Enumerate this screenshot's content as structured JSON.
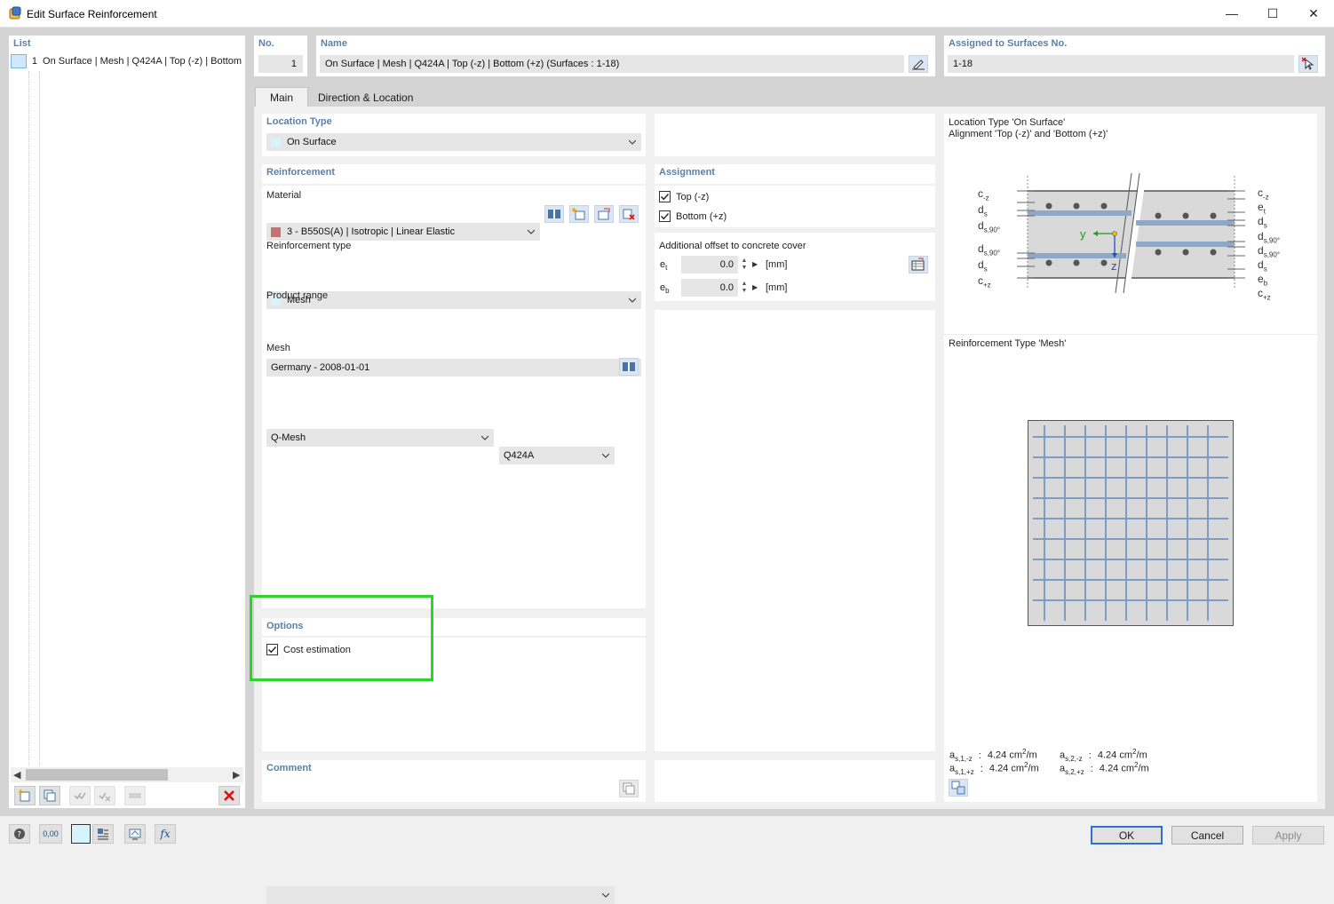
{
  "window": {
    "title": "Edit Surface Reinforcement",
    "controls": {
      "minimize": "—",
      "maximize": "☐",
      "close": "✕"
    }
  },
  "list": {
    "header": "List",
    "items": [
      {
        "no": "1",
        "label": "On Surface | Mesh | Q424A | Top (-z) | Bottom"
      }
    ]
  },
  "header": {
    "no_label": "No.",
    "no_value": "1",
    "name_label": "Name",
    "name_value": "On Surface | Mesh | Q424A | Top (-z) | Bottom (+z) (Surfaces : 1-18)",
    "assigned_label": "Assigned to Surfaces No.",
    "assigned_value": "1-18"
  },
  "tabs": [
    {
      "label": "Main",
      "active": true
    },
    {
      "label": "Direction & Location",
      "active": false
    }
  ],
  "location_type": {
    "label": "Location Type",
    "value": "On Surface",
    "swatch": "#d6f4fb"
  },
  "reinforcement": {
    "label": "Reinforcement",
    "material_label": "Material",
    "material_value": "3 - B550S(A) | Isotropic | Linear Elastic",
    "material_swatch": "#c27373",
    "type_label": "Reinforcement type",
    "type_value": "Mesh",
    "type_swatch": "#d6f4fb",
    "range_label": "Product range",
    "range_value": "Germany - 2008-01-01",
    "mesh_label": "Mesh",
    "mesh_kind": "Q-Mesh",
    "mesh_name": "Q424A"
  },
  "options": {
    "label": "Options",
    "cost_estimation_label": "Cost estimation",
    "cost_estimation": true
  },
  "comment": {
    "label": "Comment",
    "value": ""
  },
  "assignment": {
    "label": "Assignment",
    "top_label": "Top (-z)",
    "top_checked": true,
    "bottom_label": "Bottom (+z)",
    "bottom_checked": true
  },
  "offset": {
    "label": "Additional offset to concrete cover",
    "rows": [
      {
        "symbol": "e",
        "sub": "t",
        "value": "0.0",
        "unit": "[mm]"
      },
      {
        "symbol": "e",
        "sub": "b",
        "value": "0.0",
        "unit": "[mm]"
      }
    ]
  },
  "preview": {
    "location_title_line1": "Location Type 'On Surface'",
    "location_title_line2": "Alignment 'Top (-z)' and 'Bottom (+z)'",
    "left_labels": [
      {
        "base": "c",
        "sub": "-z"
      },
      {
        "base": "d",
        "sub": "s"
      },
      {
        "base": "d",
        "sub": "s,90°"
      },
      {
        "base": "d",
        "sub": "s,90°"
      },
      {
        "base": "d",
        "sub": "s"
      },
      {
        "base": "c",
        "sub": "+z"
      }
    ],
    "right_labels": [
      {
        "base": "c",
        "sub": "-z"
      },
      {
        "base": "e",
        "sub": "t"
      },
      {
        "base": "d",
        "sub": "s"
      },
      {
        "base": "d",
        "sub": "s,90°"
      },
      {
        "base": "d",
        "sub": "s,90°"
      },
      {
        "base": "d",
        "sub": "s"
      },
      {
        "base": "e",
        "sub": "b"
      },
      {
        "base": "c",
        "sub": "+z"
      }
    ],
    "axis_y": "y",
    "axis_z": "z",
    "mesh_title": "Reinforcement Type 'Mesh'",
    "areas": [
      {
        "base": "a",
        "sub": "s,1,-z",
        "sep": ":",
        "value": "4.24 cm",
        "exp": "2",
        "unit": "/m"
      },
      {
        "base": "a",
        "sub": "s,2,-z",
        "sep": ":",
        "value": "4.24 cm",
        "exp": "2",
        "unit": "/m"
      },
      {
        "base": "a",
        "sub": "s,1,+z",
        "sep": ":",
        "value": "4.24 cm",
        "exp": "2",
        "unit": "/m"
      },
      {
        "base": "a",
        "sub": "s,2,+z",
        "sep": ":",
        "value": "4.24 cm",
        "exp": "2",
        "unit": "/m"
      }
    ]
  },
  "buttons": {
    "ok": "OK",
    "cancel": "Cancel",
    "apply": "Apply"
  },
  "bottom_tools": {
    "units_label": "0,00",
    "formula_label": "fx"
  },
  "colors": {
    "accent": "#5b7fa8",
    "highlight": "#2bd62b",
    "rebar": "#8ea9c8",
    "mesh_line": "#7d9dc2",
    "slab": "#d9d9d9"
  }
}
